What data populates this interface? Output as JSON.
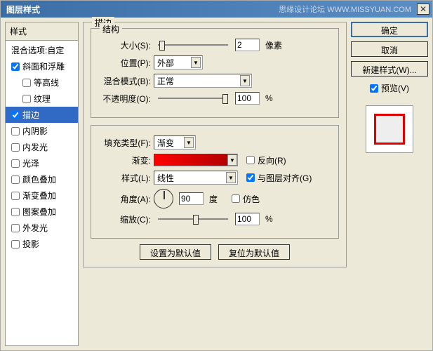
{
  "titlebar": {
    "title": "图层样式",
    "watermark": "思缘设计论坛  WWW.MISSYUAN.COM",
    "close": "✕"
  },
  "styles": {
    "header": "样式",
    "blend_label": "混合选项:自定",
    "items": [
      {
        "label": "斜面和浮雕",
        "checked": true
      },
      {
        "label": "等高线",
        "checked": false,
        "indent": true
      },
      {
        "label": "纹理",
        "checked": false,
        "indent": true
      },
      {
        "label": "描边",
        "checked": true,
        "selected": true
      },
      {
        "label": "内阴影",
        "checked": false
      },
      {
        "label": "内发光",
        "checked": false
      },
      {
        "label": "光泽",
        "checked": false
      },
      {
        "label": "颜色叠加",
        "checked": false
      },
      {
        "label": "渐变叠加",
        "checked": false
      },
      {
        "label": "图案叠加",
        "checked": false
      },
      {
        "label": "外发光",
        "checked": false
      },
      {
        "label": "投影",
        "checked": false
      }
    ]
  },
  "stroke": {
    "title": "描边",
    "structure": {
      "title": "结构",
      "size_label": "大小(S):",
      "size_value": "2",
      "size_unit": "像素",
      "position_label": "位置(P):",
      "position_value": "外部",
      "blend_label": "混合模式(B):",
      "blend_value": "正常",
      "opacity_label": "不透明度(O):",
      "opacity_value": "100",
      "opacity_unit": "%"
    },
    "fill": {
      "fill_type_label": "填充类型(F):",
      "fill_type_value": "渐变",
      "gradient_label": "渐变:",
      "reverse_label": "反向(R)",
      "style_label": "样式(L):",
      "style_value": "线性",
      "align_label": "与图层对齐(G)",
      "angle_label": "角度(A):",
      "angle_value": "90",
      "angle_unit": "度",
      "dither_label": "仿色",
      "scale_label": "缩放(C):",
      "scale_value": "100",
      "scale_unit": "%"
    },
    "default_set": "设置为默认值",
    "default_reset": "复位为默认值"
  },
  "buttons": {
    "ok": "确定",
    "cancel": "取消",
    "new_style": "新建样式(W)...",
    "preview": "预览(V)"
  }
}
